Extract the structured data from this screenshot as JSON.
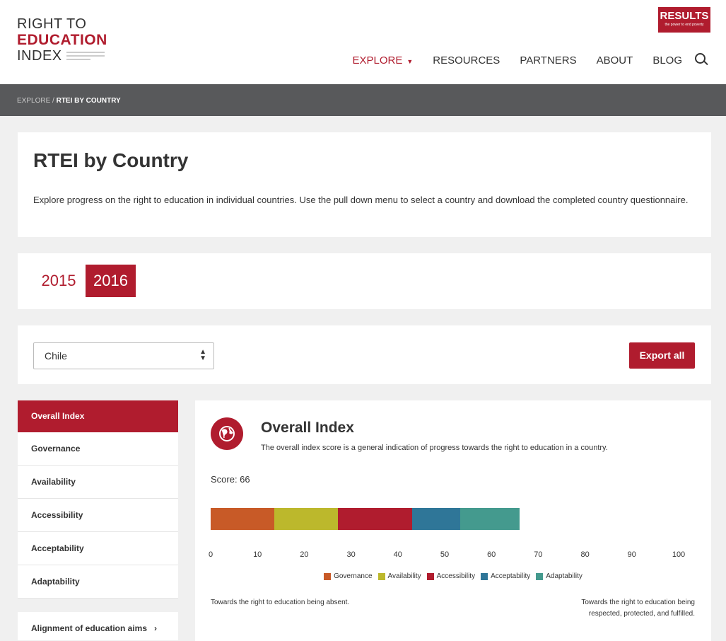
{
  "header": {
    "logo_line1": "RIGHT TO",
    "logo_line2": "EDUCATION",
    "logo_line3": "INDEX",
    "results_badge": "RESULTS",
    "results_tagline": "the power to end poverty",
    "nav": [
      {
        "label": "EXPLORE",
        "active": true
      },
      {
        "label": "RESOURCES"
      },
      {
        "label": "PARTNERS"
      },
      {
        "label": "ABOUT"
      },
      {
        "label": "BLOG"
      }
    ],
    "nav_explore_caret": "▼"
  },
  "breadcrumb": {
    "parent": "EXPLORE",
    "separator": " / ",
    "current": "RTEI BY COUNTRY"
  },
  "intro": {
    "title": "RTEI by Country",
    "description": "Explore progress on the right to education in individual countries. Use the pull down menu to select a country and download the completed country questionnaire."
  },
  "years": {
    "y2015": "2015",
    "y2016": "2016",
    "selected": "2016"
  },
  "country_select": {
    "value": "Chile",
    "arrow": "▲▼"
  },
  "export_label": "Export all",
  "sidebar": {
    "items": [
      {
        "label": "Overall Index",
        "active": true
      },
      {
        "label": "Governance"
      },
      {
        "label": "Availability"
      },
      {
        "label": "Accessibility"
      },
      {
        "label": "Acceptability"
      },
      {
        "label": "Adaptability"
      }
    ],
    "extra_item": "Alignment of education aims",
    "extra_chevron": "›"
  },
  "panel": {
    "icon": "globe-icon",
    "title": "Overall Index",
    "description": "The overall index score is a general indication of progress towards the right to education in a country.",
    "score_text": "Score: 66",
    "note_left": "Towards the right to education being absent.",
    "note_right": "Towards the right to education being respected, protected, and fulfilled."
  },
  "chart_data": {
    "type": "bar",
    "orientation": "horizontal-stacked",
    "total": 66,
    "xlim": [
      0,
      100
    ],
    "ticks": [
      "0",
      "10",
      "20",
      "30",
      "40",
      "50",
      "60",
      "70",
      "80",
      "90",
      "100"
    ],
    "series": [
      {
        "name": "Governance",
        "value": 13.6,
        "color": "#c85a27"
      },
      {
        "name": "Availability",
        "value": 13.6,
        "color": "#bcb82c"
      },
      {
        "name": "Accessibility",
        "value": 15.9,
        "color": "#b01c2e"
      },
      {
        "name": "Acceptability",
        "value": 10.2,
        "color": "#2f7698"
      },
      {
        "name": "Adaptability",
        "value": 12.7,
        "color": "#449a8e"
      }
    ]
  },
  "colors": {
    "accent": "#b01c2e",
    "breadcrumb_bg": "#58595b"
  }
}
